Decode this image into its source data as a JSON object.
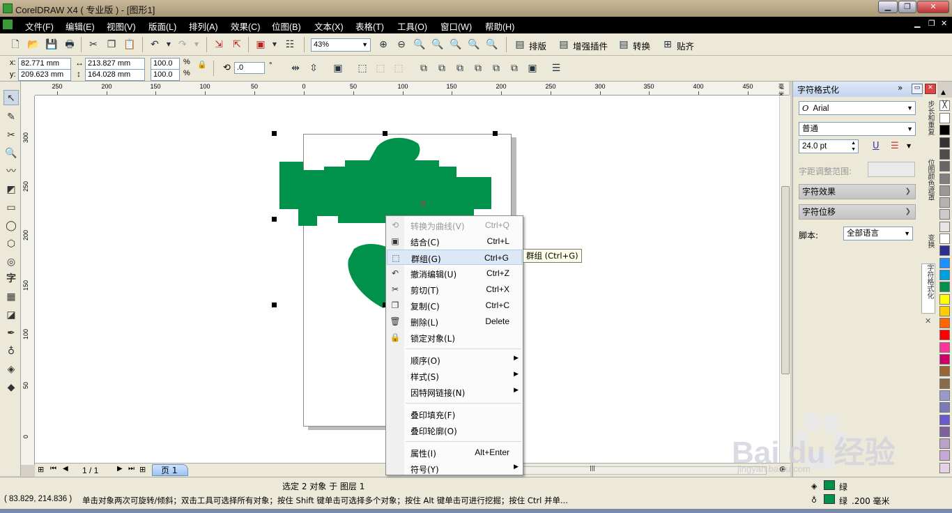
{
  "title": "CorelDRAW X4 ( 专业版 ) - [图形1]",
  "menu": [
    "文件(F)",
    "编辑(E)",
    "视图(V)",
    "版面(L)",
    "排列(A)",
    "效果(C)",
    "位图(B)",
    "文本(X)",
    "表格(T)",
    "工具(O)",
    "窗口(W)",
    "帮助(H)"
  ],
  "toolbar": {
    "zoom": "43%",
    "buttons": [
      "排版",
      "增强插件",
      "转换",
      "贴齐"
    ]
  },
  "propbar": {
    "x": "82.771 mm",
    "y": "209.623 mm",
    "w": "213.827 mm",
    "h": "164.028 mm",
    "scale_x": "100.0",
    "scale_y": "100.0",
    "pct": "%",
    "rotation": ".0",
    "degree": "°",
    "x_label": "x:",
    "y_label": "y:"
  },
  "ruler_h": [
    "250",
    "200",
    "150",
    "100",
    "50",
    "0",
    "50",
    "100",
    "150",
    "200",
    "250",
    "300",
    "350",
    "400",
    "450"
  ],
  "ruler_h_unit": "毫米",
  "ruler_v": [
    "300",
    "250",
    "200",
    "150",
    "100",
    "50",
    "0"
  ],
  "context_menu": [
    {
      "icon": "convert-curve-icon",
      "glyph": "⟲",
      "label": "转换为曲线(V)",
      "shortcut": "Ctrl+Q",
      "disabled": true
    },
    {
      "icon": "combine-icon",
      "glyph": "▣",
      "label": "结合(C)",
      "shortcut": "Ctrl+L"
    },
    {
      "icon": "group-icon",
      "glyph": "⬚",
      "label": "群组(G)",
      "shortcut": "Ctrl+G",
      "highlight": true
    },
    {
      "icon": "undo-icon",
      "glyph": "↶",
      "label": "撤消编辑(U)",
      "shortcut": "Ctrl+Z"
    },
    {
      "icon": "cut-icon",
      "glyph": "✂",
      "label": "剪切(T)",
      "shortcut": "Ctrl+X"
    },
    {
      "icon": "copy-icon",
      "glyph": "❐",
      "label": "复制(C)",
      "shortcut": "Ctrl+C"
    },
    {
      "icon": "delete-icon",
      "glyph": "🗑",
      "label": "删除(L)",
      "shortcut": "Delete"
    },
    {
      "icon": "lock-icon",
      "glyph": "🔒",
      "label": "锁定对象(L)",
      "shortcut": ""
    },
    {
      "sep": true
    },
    {
      "label": "顺序(O)",
      "submenu": true
    },
    {
      "label": "样式(S)",
      "submenu": true
    },
    {
      "label": "因特网链接(N)",
      "submenu": true
    },
    {
      "sep": true
    },
    {
      "label": "叠印填充(F)"
    },
    {
      "label": "叠印轮廓(O)"
    },
    {
      "sep": true
    },
    {
      "label": "属性(I)",
      "shortcut": "Alt+Enter"
    },
    {
      "label": "符号(Y)",
      "submenu": true
    }
  ],
  "tooltip": "群组 (Ctrl+G)",
  "pagebar": {
    "page_count": "1 / 1",
    "page_tab": "页 1"
  },
  "status": {
    "selection": "选定 2 对象 于 图层 1",
    "coords": "( 83.829, 214.836 )",
    "hint": "单击对象两次可旋转/倾斜；双击工具可选择所有对象；按住 Shift 键单击可选择多个对象；按住 Alt 键单击可进行挖掘；按住 Ctrl 并单...",
    "fill_name": "绿",
    "outline_name": "绿",
    "outline_width": ".200 毫米"
  },
  "docker": {
    "title": "字符格式化",
    "font": "Arial",
    "style": "普通",
    "size": "24.0 pt",
    "kerning_label": "字距调整范围:",
    "section1": "字符效果",
    "section2": "字符位移",
    "script_label": "脚本:",
    "script_value": "全部语言",
    "tabs": [
      "步长和重复",
      "位图颜色遮罩",
      "变换",
      "字符格式化"
    ]
  },
  "colors": {
    "shape": "#00924a",
    "palette": [
      "#ffffff",
      "#000000",
      "#333333",
      "#4d4d4d",
      "#666666",
      "#808080",
      "#999999",
      "#b3b3b3",
      "#cccccc",
      "#e6e6e6",
      "#ffffff",
      "#2e2e8e",
      "#1e90ff",
      "#00a0e0",
      "#00924a",
      "#ffff00",
      "#ffcc00",
      "#ff6600",
      "#ff0000",
      "#ff3399",
      "#cc0066",
      "#996633",
      "#8b6b4a",
      "#9999cc",
      "#7b7bb8",
      "#6a5acd",
      "#8060a0",
      "#bba0c8",
      "#c8a8d8",
      "#e8d0e8"
    ]
  },
  "watermark": {
    "brand": "Bai du 经验",
    "url": "jingyan.baidu.com"
  }
}
